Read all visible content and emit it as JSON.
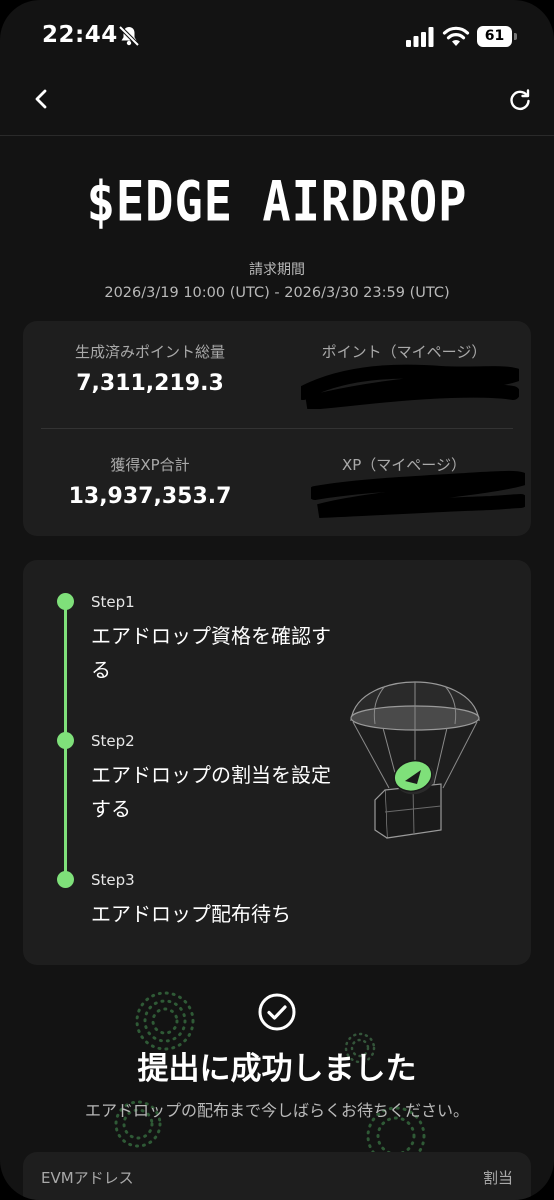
{
  "status_bar": {
    "time": "22:44",
    "battery": "61",
    "icons": [
      "bell-slash-icon",
      "signal-icon",
      "wifi-icon",
      "battery-icon"
    ]
  },
  "nav": {
    "icons": [
      "chevron-left-icon",
      "refresh-icon"
    ]
  },
  "header": {
    "title": "$EDGE AIRDROP",
    "period_label": "請求期間",
    "period_value": "2026/3/19 10:00 (UTC) - 2026/3/30 23:59 (UTC)"
  },
  "stats": {
    "total_points_label": "生成済みポイント総量",
    "total_points_value": "7,311,219.3",
    "my_points_label": "ポイント（マイページ）",
    "total_xp_label": "獲得XP合計",
    "total_xp_value": "13,937,353.7",
    "my_xp_label": "XP（マイページ）"
  },
  "steps": [
    {
      "num": "Step1",
      "text": "エアドロップ資格を確認する"
    },
    {
      "num": "Step2",
      "text": "エアドロップの割当を設定する"
    },
    {
      "num": "Step3",
      "text": "エアドロップ配布待ち"
    }
  ],
  "success": {
    "title": "提出に成功しました",
    "subtitle": "エアドロップの配布まで今しばらくお待ちください。"
  },
  "address_table": {
    "col1": "EVMアドレス",
    "col2": "割当"
  },
  "colors": {
    "accent": "#7fe07a",
    "background": "#131313",
    "card": "#1e1e1e"
  }
}
